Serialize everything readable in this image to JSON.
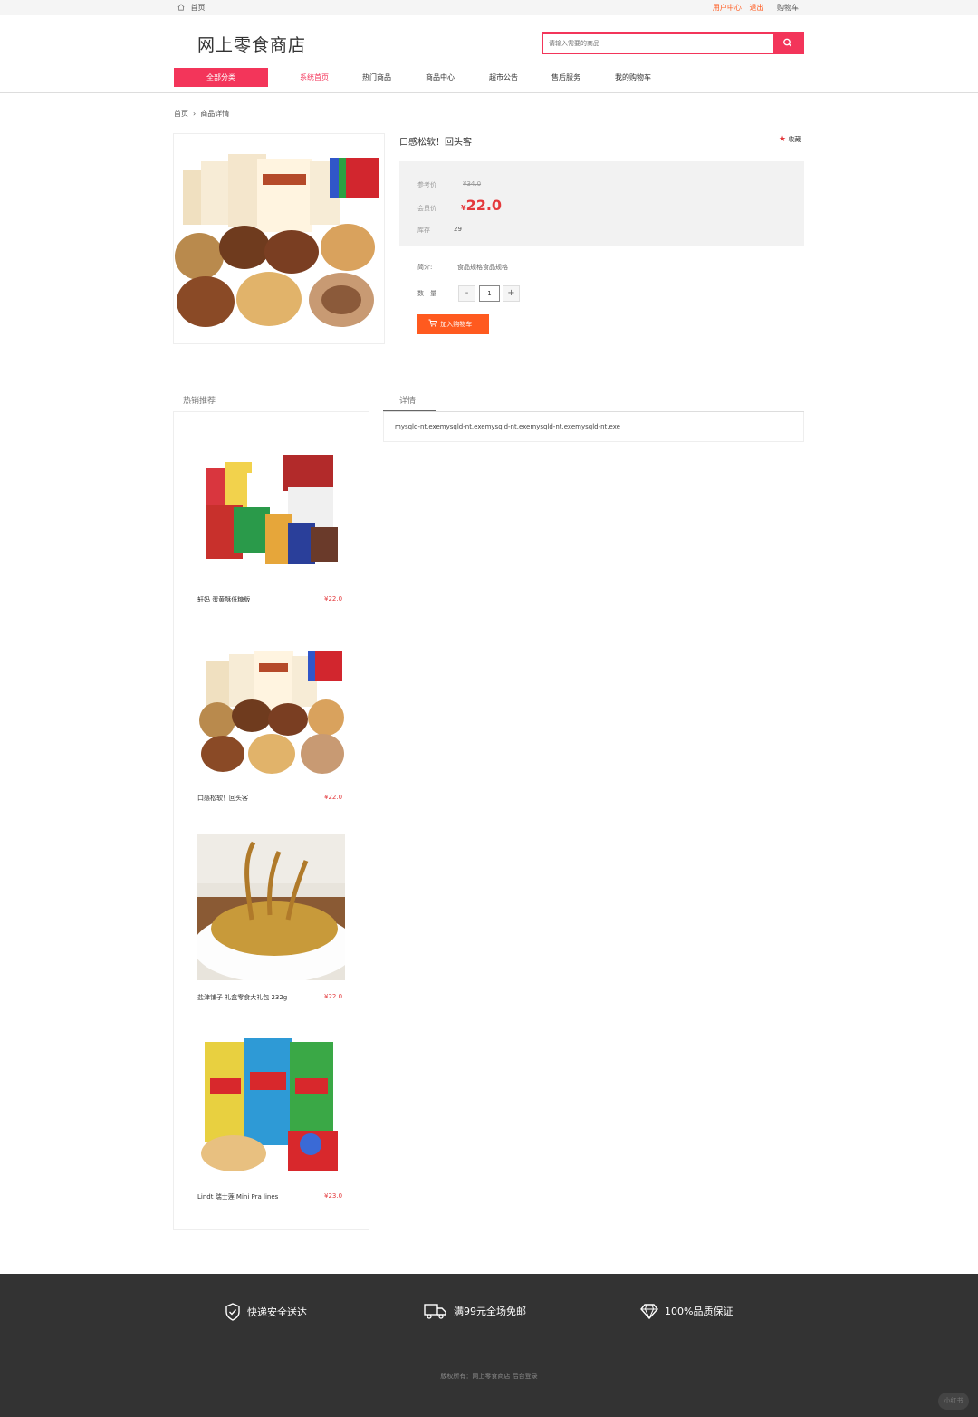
{
  "topbar": {
    "home": "首页",
    "user_center": "用户中心",
    "logout": "退出",
    "cart": "购物车"
  },
  "header": {
    "logo": "网上零食商店",
    "search_placeholder": "请输入需要的商品"
  },
  "nav": {
    "all_categories": "全部分类",
    "items": [
      "系统首页",
      "热门商品",
      "商品中心",
      "超市公告",
      "售后服务",
      "我的购物车"
    ]
  },
  "breadcrumb": {
    "home": "首页",
    "current": "商品详情"
  },
  "product": {
    "title": "口感松软！回头客",
    "favorite": "收藏",
    "ref_price_label": "参考价",
    "ref_price": "¥34.0",
    "member_price_label": "会员价",
    "currency": "¥",
    "member_price": "22.0",
    "stock_label": "库存",
    "stock": "29",
    "intro_label": "简介:",
    "intro": "食品规格食品规格",
    "quantity_label": "数　量",
    "quantity": "1",
    "minus": "-",
    "plus": "+",
    "add_to_cart": "加入购物车"
  },
  "hot": {
    "title": "热销推荐",
    "items": [
      {
        "name": "轩妈 蛋黄酥低糖版",
        "price": "¥22.0"
      },
      {
        "name": "口感松软！回头客",
        "price": "¥22.0"
      },
      {
        "name": "盐津铺子 礼盒零食大礼包 232g",
        "price": "¥22.0"
      },
      {
        "name": "Lindt 瑞士莲 Mini Pra lines",
        "price": "¥23.0"
      }
    ]
  },
  "detail": {
    "tab": "详情",
    "content": "mysqld-nt.exemysqld-nt.exemysqld-nt.exemysqld-nt.exemysqld-nt.exe"
  },
  "footer": {
    "features": [
      "快递安全送达",
      "满99元全场免邮",
      "100%品质保证"
    ],
    "copyright": "版权所有：网上零食商店 后台登录"
  },
  "watermark": "小红书",
  "colors": {
    "accent": "#f3355a",
    "price": "#e4393c",
    "cart_button": "#ff5a1f",
    "footer": "#333333"
  }
}
